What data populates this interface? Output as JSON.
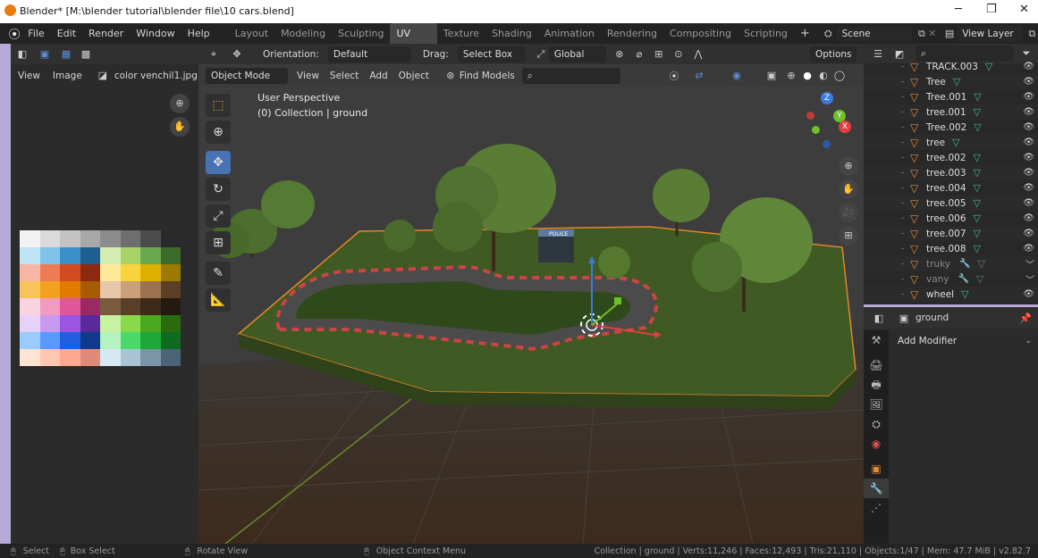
{
  "window": {
    "title": "Blender* [M:\\blender tutorial\\blender file\\10 cars.blend]",
    "minimize": "─",
    "restore": "❐",
    "close": "✕"
  },
  "menu": [
    "File",
    "Edit",
    "Render",
    "Window",
    "Help"
  ],
  "workspaces": [
    "Layout",
    "Modeling",
    "Sculpting",
    "UV Editing",
    "Texture Paint",
    "Shading",
    "Animation",
    "Rendering",
    "Compositing",
    "Scripting"
  ],
  "active_workspace": "UV Editing",
  "add_workspace": "+",
  "scene": {
    "label": "Scene",
    "view_layer": "View Layer"
  },
  "image_editor": {
    "view": "View",
    "image": "Image",
    "image_name": "color venchil1.jpg",
    "palette_colors": [
      "#f2f2f2",
      "#dadada",
      "#c3c3c3",
      "#a8a8a8",
      "#8c8c8c",
      "#6e6e6e",
      "#4c4c4c",
      "#2a2a2a",
      "#bfe3f7",
      "#7fc2ea",
      "#3a8fc9",
      "#1f5f8f",
      "#d4ecb2",
      "#a7d36a",
      "#6aa84f",
      "#3d6b2a",
      "#f7b6a3",
      "#ef7b55",
      "#d34a1f",
      "#8c2a10",
      "#fce99a",
      "#f7d43b",
      "#e0b000",
      "#9a7a00",
      "#f7c35a",
      "#f2a11f",
      "#e07b00",
      "#a85a00",
      "#e7c7a9",
      "#c9a07a",
      "#9b7350",
      "#5c3f26",
      "#f9d3e0",
      "#f29ac0",
      "#e0569a",
      "#9a2a63",
      "#7a5a3c",
      "#5a3f28",
      "#3d2a18",
      "#241a10",
      "#e6d2f7",
      "#c79af0",
      "#9a56e0",
      "#5a2a9a",
      "#c7f2a0",
      "#8ad94a",
      "#4aa81f",
      "#2a6b10",
      "#9acbff",
      "#5a9aff",
      "#1f5fe0",
      "#0f3a8c",
      "#b5f2c2",
      "#4ad96b",
      "#1fa83a",
      "#0f6b20",
      "#ffe3d3",
      "#ffc7b0",
      "#ffa890",
      "#e08a7a",
      "#d6e9f2",
      "#a9c4d4",
      "#7a94a8",
      "#4d6478"
    ]
  },
  "header": {
    "orientation_label": "Orientation:",
    "orientation_value": "Default",
    "drag_label": "Drag:",
    "drag_value": "Select Box",
    "transform_pivot": "Global",
    "options": "Options"
  },
  "viewport": {
    "mode": "Object Mode",
    "menus": [
      "View",
      "Select",
      "Add",
      "Object"
    ],
    "find_models": "Find Models",
    "perspective": "User Perspective",
    "collection": "(0) Collection | ground",
    "axis_x": "X",
    "axis_y": "Y",
    "axis_z": "Z",
    "building_sign": "POLICE"
  },
  "outliner": {
    "items": [
      {
        "name": "TRACK.003",
        "hidden": false
      },
      {
        "name": "Tree",
        "hidden": false
      },
      {
        "name": "Tree.001",
        "hidden": false
      },
      {
        "name": "tree.001",
        "hidden": false
      },
      {
        "name": "Tree.002",
        "hidden": false
      },
      {
        "name": "tree",
        "hidden": false
      },
      {
        "name": "tree.002",
        "hidden": false
      },
      {
        "name": "tree.003",
        "hidden": false
      },
      {
        "name": "tree.004",
        "hidden": false
      },
      {
        "name": "tree.005",
        "hidden": false
      },
      {
        "name": "tree.006",
        "hidden": false
      },
      {
        "name": "tree.007",
        "hidden": false
      },
      {
        "name": "tree.008",
        "hidden": false
      },
      {
        "name": "truky",
        "hidden": true
      },
      {
        "name": "vany",
        "hidden": true
      },
      {
        "name": "wheel",
        "hidden": false
      }
    ]
  },
  "properties": {
    "object_name": "ground",
    "add_modifier": "Add Modifier"
  },
  "status": {
    "select": "Select",
    "box_select": "Box Select",
    "rotate_view": "Rotate View",
    "context_menu": "Object Context Menu",
    "stats": "Collection | ground | Verts:11,246 | Faces:12,493 | Tris:21,110 | Objects:1/47 | Mem: 47.7 MiB | v2.82.7"
  }
}
